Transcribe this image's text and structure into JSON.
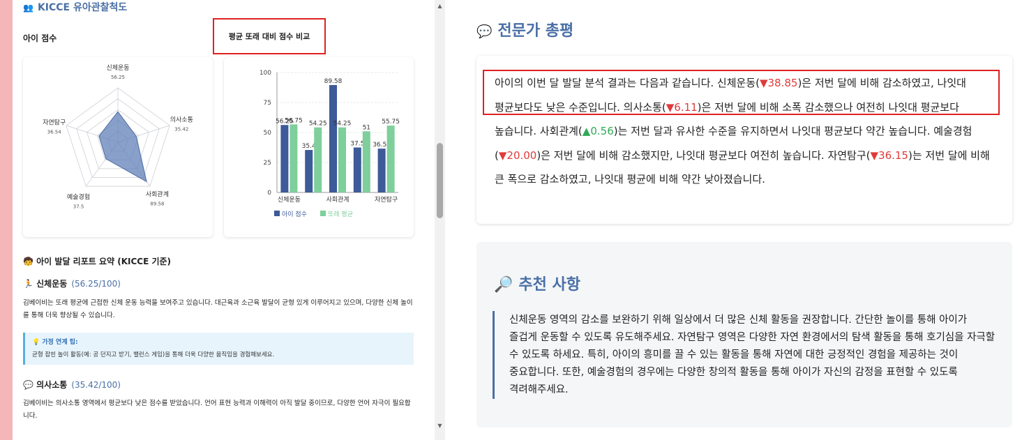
{
  "left": {
    "section_header": "KICCE 유아관찰척도",
    "score_label": "아이 점수",
    "compare_label": "평균 또래 대비 점수 비교",
    "radar": {
      "axes": [
        {
          "name": "신체운동",
          "value": "56.25",
          "v": 56.25
        },
        {
          "name": "의사소통",
          "value": "35.42",
          "v": 35.42
        },
        {
          "name": "사회관계",
          "value": "89.58",
          "v": 89.58
        },
        {
          "name": "예술경험",
          "value": "37.5",
          "v": 37.5
        },
        {
          "name": "자연탐구",
          "value": "36.54",
          "v": 36.54
        }
      ],
      "max": 100
    },
    "summary_title": "아이 발달 리포트 요약 (KICCE 기준)",
    "items": [
      {
        "name": "신체운동",
        "score": "(56.25/100)",
        "desc": "김베이비는 또래 평균에 근접한 신체 운동 능력을 보여주고 있습니다. 대근육과 소근육 발달이 균형 있게 이루어지고 있으며, 다양한 신체 놀이를 통해 더욱 향상될 수 있습니다.",
        "tip_title": "가정 연계 팁:",
        "tip_body": "균형 잡힌 놀이 활동(예: 공 던지고 받기, 밸런스 게임)을 통해 더욱 다양한 움직임을 경험해보세요."
      },
      {
        "name": "의사소통",
        "score": "(35.42/100)",
        "desc": "김베이비는 의사소통 영역에서 평균보다 낮은 점수를 받았습니다. 언어 표현 능력과 이해력이 아직 발달 중이므로, 다양한 언어 자극이 필요합니다."
      }
    ]
  },
  "chart_data": {
    "type": "bar",
    "categories": [
      "신체운동",
      "의사소통",
      "사회관계",
      "예술경험",
      "자연탐구"
    ],
    "tick_labels": [
      "신체운동",
      "사회관계",
      "자연탐구"
    ],
    "series": [
      {
        "name": "아이 점수",
        "values": [
          56.25,
          35.42,
          89.58,
          37.5,
          36.54
        ],
        "labels": [
          "56.25",
          "35.4",
          "89.58",
          "37.5",
          "36.54"
        ],
        "color": "#3d5a99"
      },
      {
        "name": "또래 평균",
        "values": [
          56.75,
          54.25,
          54.25,
          51,
          55.75
        ],
        "labels": [
          "56.75",
          "54.25",
          "54.25",
          "51",
          "55.75"
        ],
        "color": "#7ecf9b"
      }
    ],
    "yticks": [
      "0",
      "25",
      "50",
      "75",
      "100"
    ],
    "ylim": [
      0,
      100
    ],
    "legend_position": "bottom",
    "grid": true
  },
  "right": {
    "eval_title": "전문가 총평",
    "eval_text": {
      "t1": "아이의 이번 달 발달 분석 결과는 다음과 같습니다. 신체운동(",
      "v1": "▼38.85",
      "t2": ")은 저번 달에 비해 감소하였고, 나잇대 평균보다도 낮은 수준입니다. 의사소통(",
      "v2": "▼6.11",
      "t3": ")은 저번 달에 비해 소폭 감소했으나 여전히 나잇대 평균보다 높습니다. 사회관계(",
      "v3": "▲0.56",
      "t4": ")는 저번 달과 유사한 수준을 유지하면서 나잇대 평균보다 약간 높습니다. 예술경험(",
      "v4": "▼20.00",
      "t5": ")은 저번 달에 비해 감소했지만, 나잇대 평균보다 여전히 높습니다. 자연탐구(",
      "v5": "▼36.15",
      "t6": ")는 저번 달에 비해 큰 폭으로 감소하였고, 나잇대 평균에 비해 약간 낮아졌습니다."
    },
    "rec_title": "추천 사항",
    "rec_text": "신체운동 영역의 감소를 보완하기 위해 일상에서 더 많은 신체 활동을 권장합니다. 간단한 놀이를 통해 아이가 즐겁게 운동할 수 있도록 유도해주세요. 자연탐구 영역은 다양한 자연 환경에서의 탐색 활동을 통해 호기심을 자극할 수 있도록 하세요. 특히, 아이의 흥미를 끌 수 있는 활동을 통해 자연에 대한 긍정적인 경험을 제공하는 것이 중요합니다. 또한, 예술경험의 경우에는 다양한 창의적 활동을 통해 아이가 자신의 감정을 표현할 수 있도록 격려해주세요."
  },
  "colors": {
    "accent": "#4a6fa5",
    "down": "#e03b3b",
    "up": "#2eaa55",
    "frame": "#f4b6b9",
    "radar_fill": "#5b7db5"
  },
  "icons": {
    "section_header": "users-icon",
    "summary": "face-emoji-icon",
    "physical": "running-person-icon",
    "communication": "chat-bubbles-icon",
    "tip": "lightbulb-icon",
    "eval": "chat-bubbles-icon",
    "rec": "magnifier-icon"
  }
}
